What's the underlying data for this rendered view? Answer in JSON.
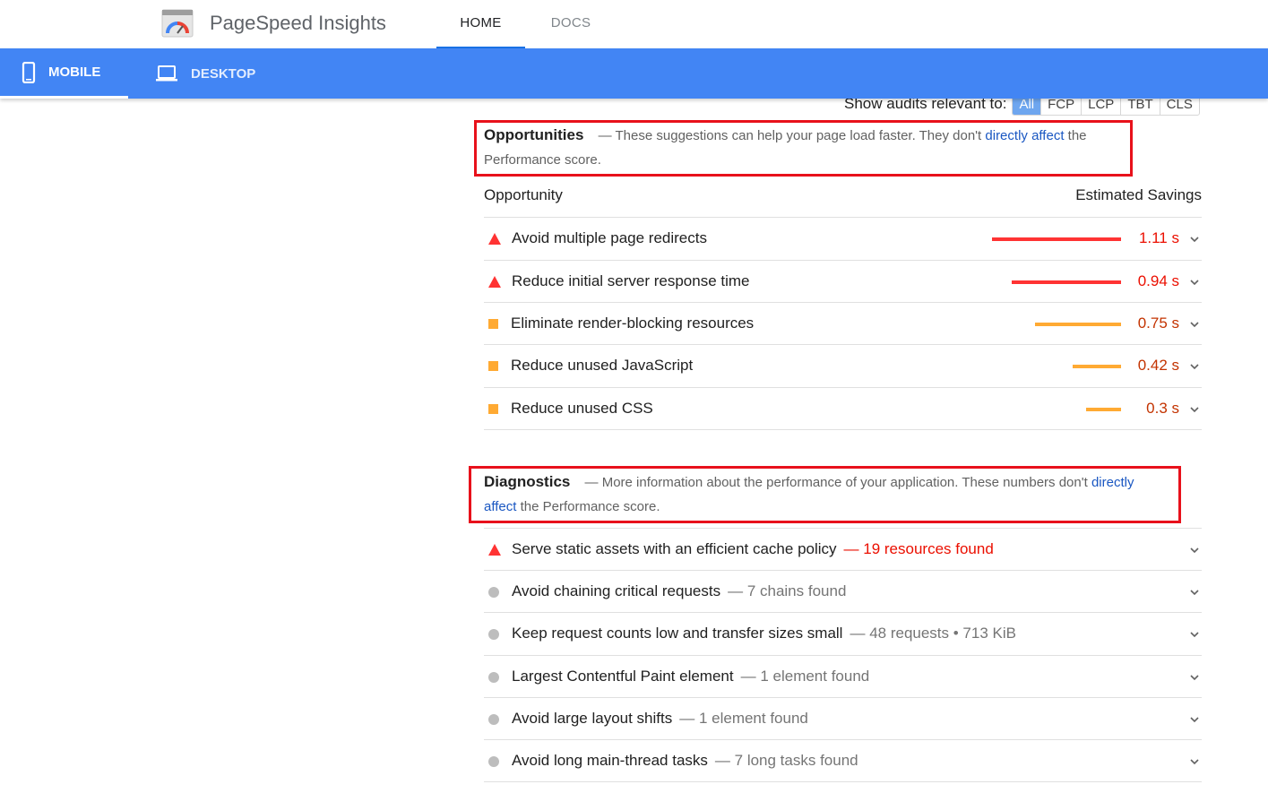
{
  "header": {
    "app_title": "PageSpeed Insights",
    "logo_icon": "pagespeed-gauge-icon",
    "nav": [
      {
        "label": "HOME",
        "active": true
      },
      {
        "label": "DOCS",
        "active": false
      }
    ]
  },
  "device_tabs": [
    {
      "label": "MOBILE",
      "icon": "phone-icon",
      "active": true
    },
    {
      "label": "DESKTOP",
      "icon": "laptop-icon",
      "active": false
    }
  ],
  "filter": {
    "label": "Show audits relevant to:",
    "chips": [
      {
        "label": "All",
        "active": true
      },
      {
        "label": "FCP",
        "active": false
      },
      {
        "label": "LCP",
        "active": false
      },
      {
        "label": "TBT",
        "active": false
      },
      {
        "label": "CLS",
        "active": false
      }
    ]
  },
  "opportunities": {
    "title": "Opportunities",
    "desc_before": "— These suggestions can help your page load faster. They don't ",
    "link_text": "directly affect",
    "desc_after_line1": " the",
    "desc_line2": "Performance score.",
    "col_left": "Opportunity",
    "col_right": "Estimated Savings",
    "items": [
      {
        "title": "Avoid multiple page redirects",
        "value": "1.11 s",
        "severity": "fail",
        "bar_fraction": 1.0
      },
      {
        "title": "Reduce initial server response time",
        "value": "0.94 s",
        "severity": "fail",
        "bar_fraction": 0.85
      },
      {
        "title": "Eliminate render-blocking resources",
        "value": "0.75 s",
        "severity": "average",
        "bar_fraction": 0.67
      },
      {
        "title": "Reduce unused JavaScript",
        "value": "0.42 s",
        "severity": "average",
        "bar_fraction": 0.375
      },
      {
        "title": "Reduce unused CSS",
        "value": "0.3 s",
        "severity": "average",
        "bar_fraction": 0.27
      }
    ]
  },
  "diagnostics": {
    "title": "Diagnostics",
    "desc_before": "— More information about the performance of your application. These numbers don't ",
    "link_line1": "directly",
    "link_line2": "affect",
    "desc_after": " the Performance score.",
    "items": [
      {
        "title": "Serve static assets with an efficient cache policy",
        "detail": "— 19 resources found",
        "severity": "fail"
      },
      {
        "title": "Avoid chaining critical requests",
        "detail": "— 7 chains found",
        "severity": "info"
      },
      {
        "title": "Keep request counts low and transfer sizes small",
        "detail": "— 48 requests • 713 KiB",
        "severity": "info"
      },
      {
        "title": "Largest Contentful Paint element",
        "detail": "— 1 element found",
        "severity": "info"
      },
      {
        "title": "Avoid large layout shifts",
        "detail": "— 1 element found",
        "severity": "info"
      },
      {
        "title": "Avoid long main-thread tasks",
        "detail": "— 7 long tasks found",
        "severity": "info"
      }
    ]
  },
  "colors": {
    "brand_blue": "#4285f4",
    "fail": "#ff3333",
    "fail_text": "#eb0f00",
    "average": "#ffaa33",
    "average_text": "#c33300",
    "info": "#bdbdbd",
    "highlight_box": "#e8111b"
  }
}
